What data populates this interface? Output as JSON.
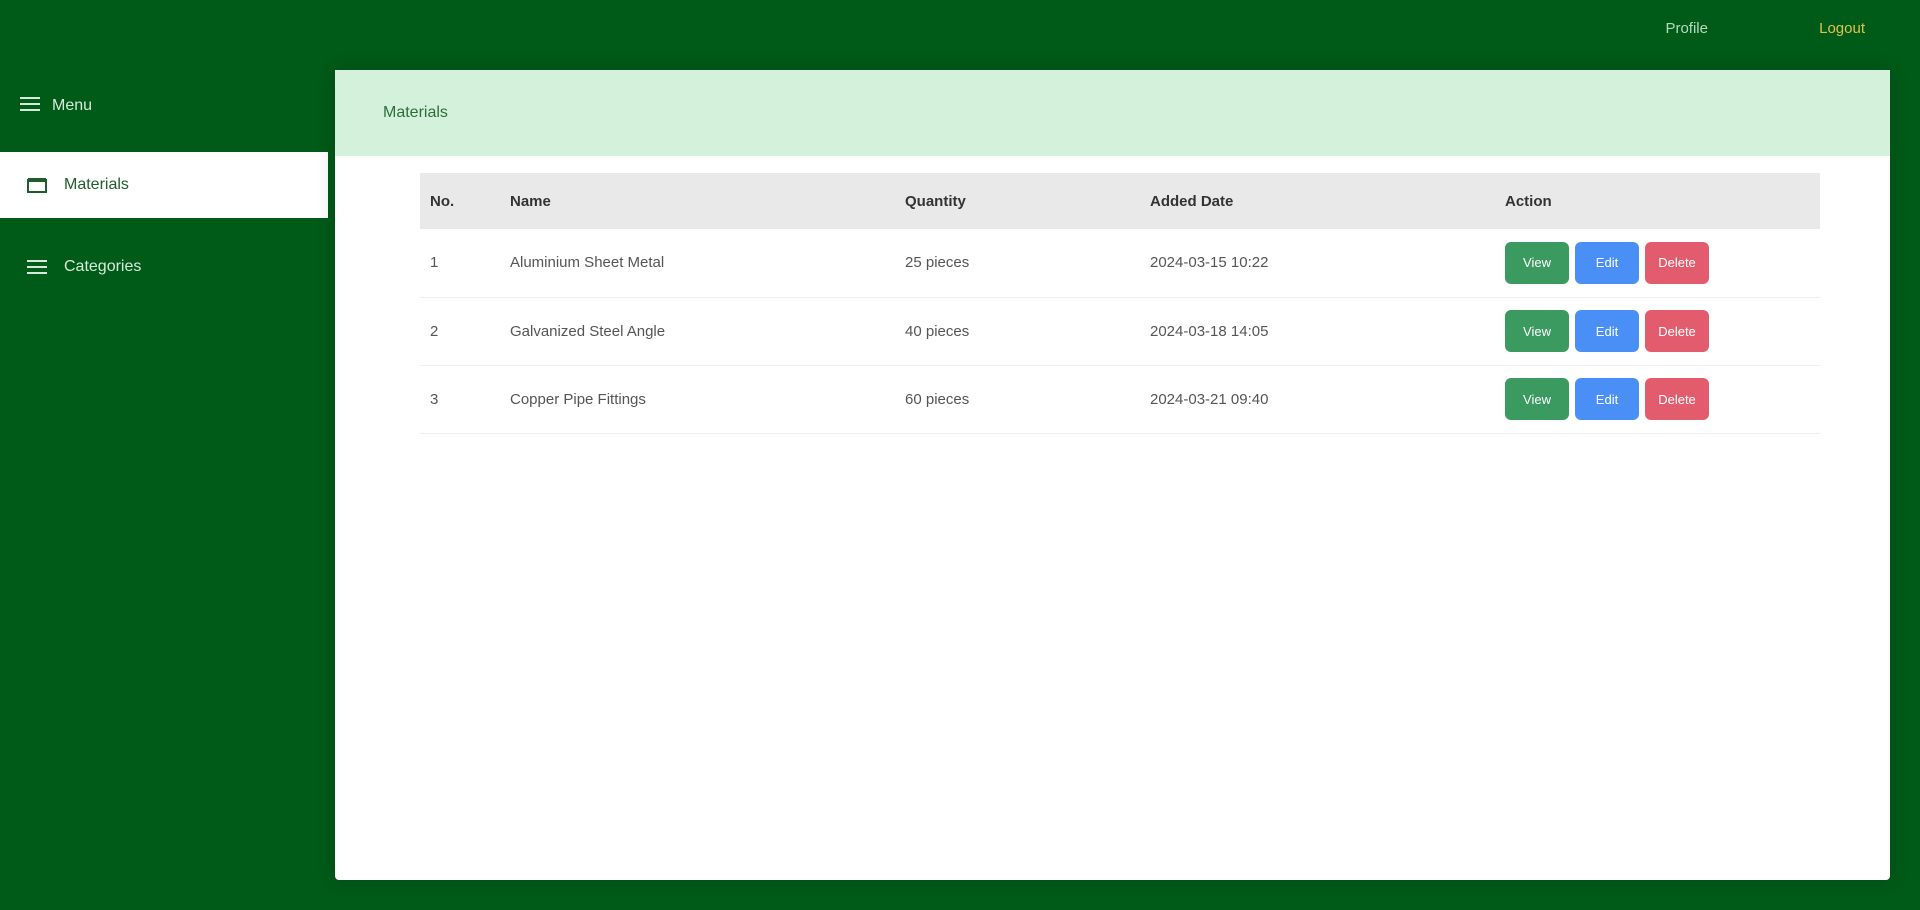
{
  "header": {
    "profile_link": "Profile",
    "logout_link": "Logout"
  },
  "sidebar": {
    "title": "Menu",
    "items": [
      {
        "label": "Materials",
        "icon": "box-icon",
        "active": true
      },
      {
        "label": "Categories",
        "icon": "list-icon",
        "active": false
      }
    ]
  },
  "main": {
    "card_title": "Materials",
    "table": {
      "columns": [
        "No.",
        "Name",
        "Quantity",
        "Added Date",
        "Action"
      ],
      "rows": [
        {
          "no": "1",
          "name": "Aluminium Sheet Metal",
          "qty": "25 pieces",
          "date": "2024-03-15 10:22"
        },
        {
          "no": "2",
          "name": "Galvanized Steel Angle",
          "qty": "40 pieces",
          "date": "2024-03-18 14:05"
        },
        {
          "no": "3",
          "name": "Copper Pipe Fittings",
          "qty": "60 pieces",
          "date": "2024-03-21 09:40"
        }
      ],
      "actions": {
        "view": "View",
        "edit": "Edit",
        "delete": "Delete"
      }
    }
  },
  "colors": {
    "brand_green": "#005a18",
    "header_mint": "#d4f2db",
    "view_green": "#3b9a60",
    "edit_blue": "#4a8ff5",
    "delete_red": "#e35c6e"
  }
}
